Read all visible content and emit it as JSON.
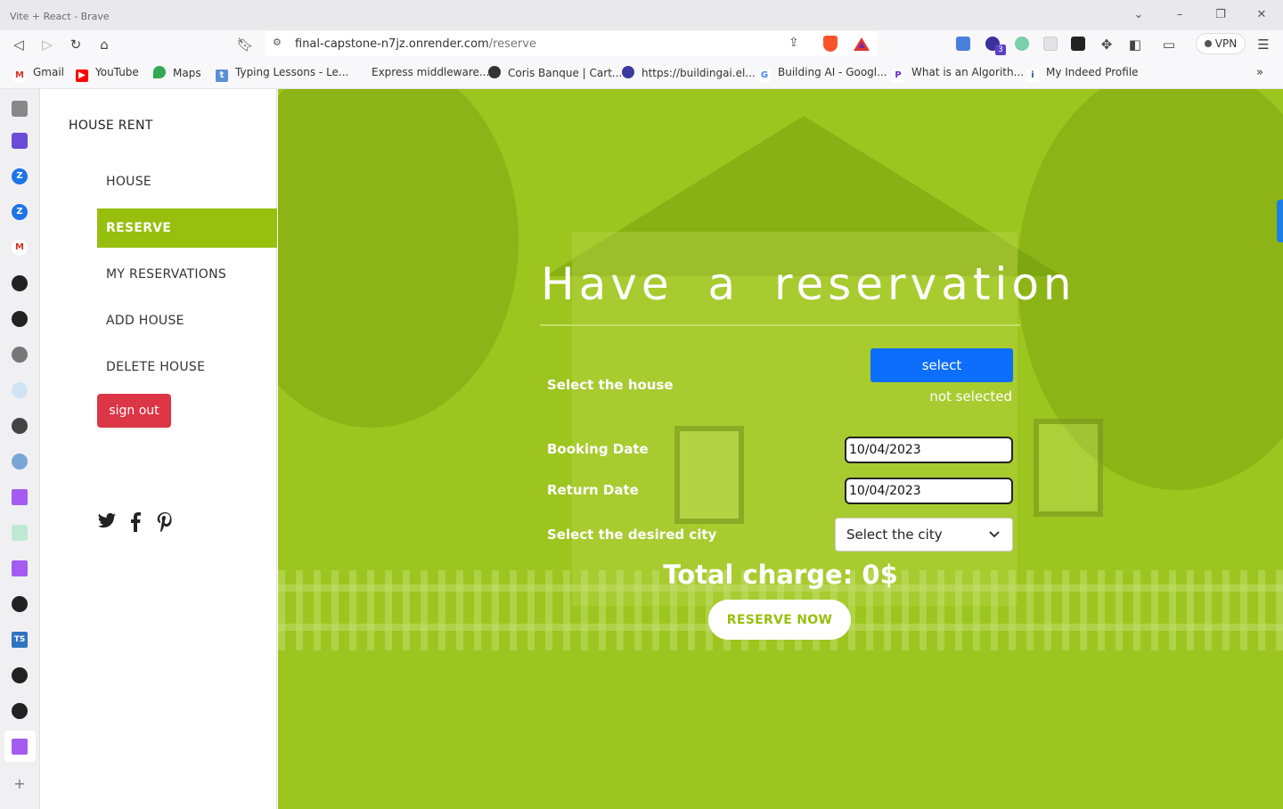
{
  "window": {
    "title": "Vite + React - Brave"
  },
  "browser": {
    "url_host": "final-capstone-n7jz.onrender.com",
    "url_path": "/reserve",
    "vpn_label": "VPN",
    "extension_badge": "3"
  },
  "bookmarks": [
    {
      "label": "Gmail"
    },
    {
      "label": "YouTube"
    },
    {
      "label": "Maps"
    },
    {
      "label": "Typing Lessons - Le..."
    },
    {
      "label": "Express middleware..."
    },
    {
      "label": "Coris Banque | Cart..."
    },
    {
      "label": "https://buildingai.el..."
    },
    {
      "label": "Building AI - Googl..."
    },
    {
      "label": "What is an Algorith..."
    },
    {
      "label": "My Indeed Profile"
    }
  ],
  "sidebar": {
    "brand": "HOUSE RENT",
    "nav": [
      {
        "label": "HOUSE"
      },
      {
        "label": "RESERVE"
      },
      {
        "label": "MY RESERVATIONS"
      },
      {
        "label": "ADD HOUSE"
      },
      {
        "label": "DELETE HOUSE"
      }
    ],
    "active_index": 1,
    "signout_label": "sign out"
  },
  "main": {
    "title": "Have a reservation",
    "house_label": "Select the house",
    "select_button": "select",
    "house_status": "not selected",
    "booking_label": "Booking Date",
    "booking_value": "10/04/2023",
    "return_label": "Return Date",
    "return_value": "10/04/2023",
    "city_label": "Select the desired city",
    "city_placeholder": "Select the city",
    "total_charge": "Total charge: 0$",
    "reserve_button": "RESERVE NOW"
  },
  "colors": {
    "accent": "#97bf0d",
    "background": "#9dc51f",
    "signout": "#dc3545",
    "select_button": "#0d6efd"
  }
}
